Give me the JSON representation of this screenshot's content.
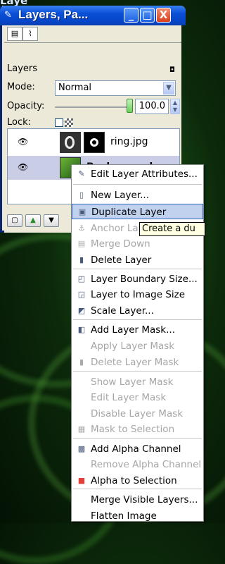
{
  "background_title_fragment": "Laye",
  "window": {
    "title": "Layers, Pa...",
    "buttons": {
      "minimize": "_",
      "maximize": "□",
      "close": "X"
    }
  },
  "dock": {
    "section_label": "Layers",
    "mode_label": "Mode:",
    "mode_value": "Normal",
    "opacity_label": "Opacity:",
    "opacity_value": "100.0",
    "opacity_fraction": 1.0,
    "lock_label": "Lock:"
  },
  "layers": [
    {
      "name": "ring.jpg",
      "selected": false,
      "visible": true
    },
    {
      "name": "Background",
      "selected": true,
      "visible": true
    }
  ],
  "context_menu": {
    "items": [
      {
        "label": "Edit Layer Attributes...",
        "icon": "edit-icon",
        "disabled": false
      },
      {
        "label": "New Layer...",
        "icon": "new-layer-icon",
        "disabled": false
      },
      {
        "label": "Duplicate Layer",
        "icon": "duplicate-icon",
        "disabled": false,
        "hover": true
      },
      {
        "label": "Anchor Layer",
        "icon": "anchor-icon",
        "disabled": true
      },
      {
        "label": "Merge Down",
        "icon": "merge-down-icon",
        "disabled": true
      },
      {
        "label": "Delete Layer",
        "icon": "delete-icon",
        "disabled": false
      },
      {
        "label": "Layer Boundary Size...",
        "icon": "boundary-icon",
        "disabled": false
      },
      {
        "label": "Layer to Image Size",
        "icon": "layer-to-image-icon",
        "disabled": false
      },
      {
        "label": "Scale Layer...",
        "icon": "scale-icon",
        "disabled": false
      },
      {
        "label": "Add Layer Mask...",
        "icon": "add-mask-icon",
        "disabled": false
      },
      {
        "label": "Apply Layer Mask",
        "icon": "",
        "disabled": true
      },
      {
        "label": "Delete Layer Mask",
        "icon": "delete-mask-icon",
        "disabled": true
      },
      {
        "label": "Show Layer Mask",
        "icon": "",
        "disabled": true
      },
      {
        "label": "Edit Layer Mask",
        "icon": "",
        "disabled": true
      },
      {
        "label": "Disable Layer Mask",
        "icon": "",
        "disabled": true
      },
      {
        "label": "Mask to Selection",
        "icon": "mask-selection-icon",
        "disabled": true
      },
      {
        "label": "Add Alpha Channel",
        "icon": "alpha-channel-icon",
        "disabled": false
      },
      {
        "label": "Remove Alpha Channel",
        "icon": "",
        "disabled": true
      },
      {
        "label": "Alpha to Selection",
        "icon": "alpha-selection-icon",
        "disabled": false
      },
      {
        "label": "Merge Visible Layers...",
        "icon": "",
        "disabled": false
      },
      {
        "label": "Flatten Image",
        "icon": "",
        "disabled": false
      }
    ]
  },
  "tooltip": "Create a du",
  "colors": {
    "hover_bg": "#c1d2ee",
    "selected_row": "#c9cde6",
    "title_blue": "#0a4fd6"
  }
}
